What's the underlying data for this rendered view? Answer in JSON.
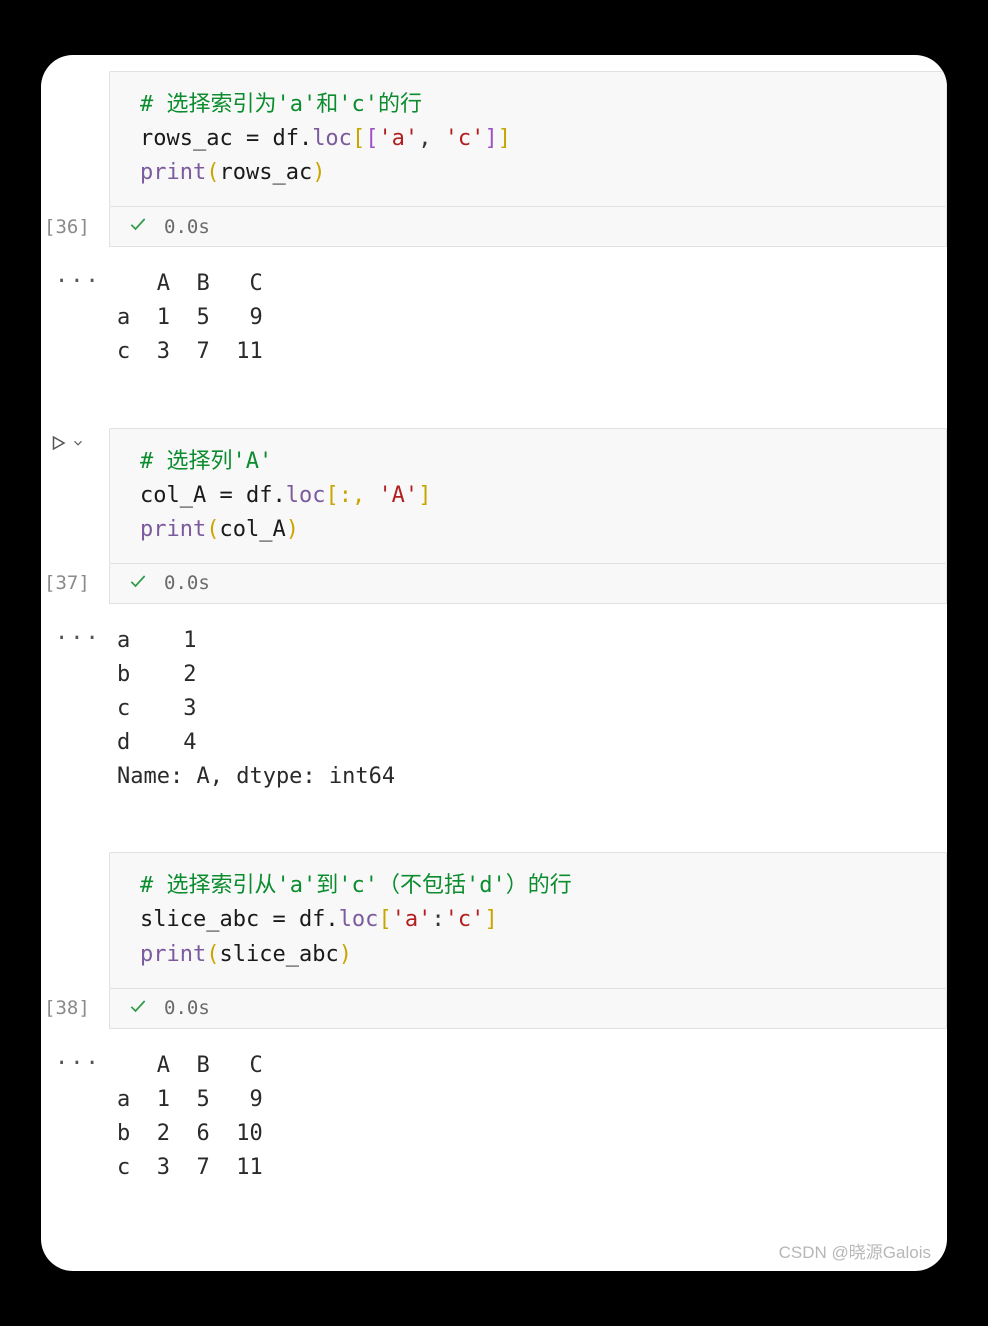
{
  "cells": [
    {
      "exec_label": "[36]",
      "duration": "0.0s",
      "show_run": false,
      "comment": "# 选择索引为'a'和'c'的行",
      "line2_pre": "rows_ac = df.",
      "line2_loc": "loc",
      "line2_post1": "[[",
      "line2_str1": "'a'",
      "line2_comma": ", ",
      "line2_str2": "'c'",
      "line2_post2": "]]",
      "line3_func": "print",
      "line3_arg": "rows_ac",
      "output": "   A  B   C\na  1  5   9\nc  3  7  11"
    },
    {
      "exec_label": "[37]",
      "duration": "0.0s",
      "show_run": true,
      "comment": "# 选择列'A'",
      "line2_pre": "col_A = df.",
      "line2_loc": "loc",
      "line2_post1": "[:, ",
      "line2_str1": "'A'",
      "line2_post2": "]",
      "line3_func": "print",
      "line3_arg": "col_A",
      "output": "a    1\nb    2\nc    3\nd    4\nName: A, dtype: int64"
    },
    {
      "exec_label": "[38]",
      "duration": "0.0s",
      "show_run": false,
      "comment": "# 选择索引从'a'到'c'（不包括'd'）的行",
      "line2_pre": "slice_abc = df.",
      "line2_loc": "loc",
      "line2_post1": "[",
      "line2_str1": "'a'",
      "line2_colon": ":",
      "line2_str2": "'c'",
      "line2_post2": "]",
      "line3_func": "print",
      "line3_arg": "slice_abc",
      "output": "   A  B   C\na  1  5   9\nb  2  6  10\nc  3  7  11"
    }
  ],
  "watermark": "CSDN @晓源Galois"
}
